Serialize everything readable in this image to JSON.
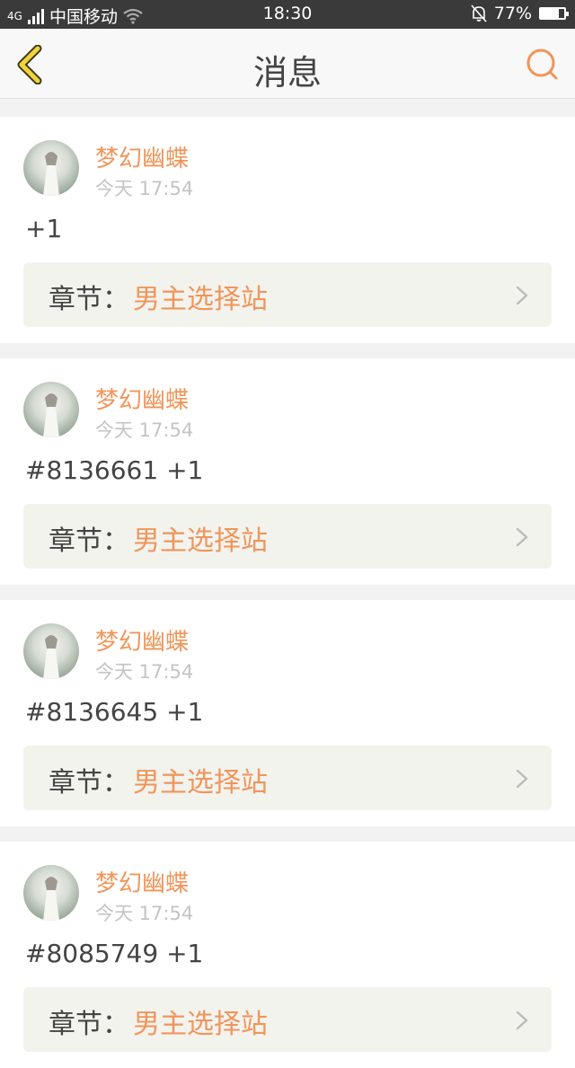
{
  "status_bar": {
    "network": "4G",
    "carrier": "中国移动",
    "time": "18:30",
    "battery": "77%",
    "battery_level": 0.77
  },
  "header": {
    "title": "消息",
    "back_icon": "chevron-left-icon",
    "search_icon": "search-icon"
  },
  "colors": {
    "accent": "#f0955a",
    "back_icon": "#f2d33a"
  },
  "messages": [
    {
      "username": "梦幻幽蝶",
      "time": "今天 17:54",
      "content": "+1",
      "chapter_label": "章节：",
      "chapter_name": "男主选择站"
    },
    {
      "username": "梦幻幽蝶",
      "time": "今天 17:54",
      "content": "#8136661 +1",
      "chapter_label": "章节：",
      "chapter_name": "男主选择站"
    },
    {
      "username": "梦幻幽蝶",
      "time": "今天 17:54",
      "content": "#8136645 +1",
      "chapter_label": "章节：",
      "chapter_name": "男主选择站"
    },
    {
      "username": "梦幻幽蝶",
      "time": "今天 17:54",
      "content": "#8085749 +1",
      "chapter_label": "章节：",
      "chapter_name": "男主选择站"
    }
  ]
}
